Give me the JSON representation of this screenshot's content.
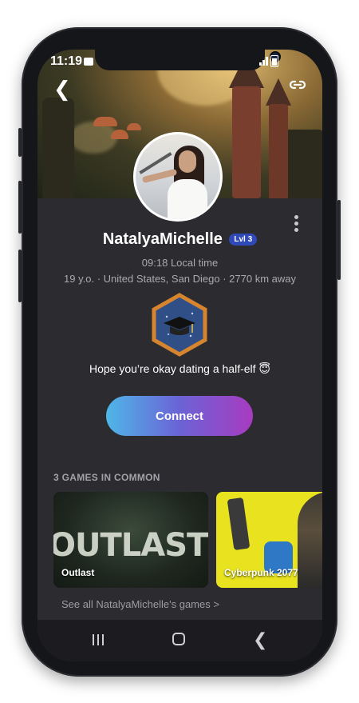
{
  "status_bar": {
    "time": "11:19"
  },
  "profile": {
    "username": "NatalyaMichelle",
    "level_badge": "Lvl 3",
    "local_time": "09:18 Local time",
    "info_line": "19 y.o. · United States, San Diego ·  2770 km away",
    "bio": "Hope you’re okay dating a half-elf 😇"
  },
  "actions": {
    "connect_label": "Connect"
  },
  "games_section": {
    "title": "3 GAMES IN COMMON",
    "games": [
      {
        "title": "Outlast",
        "art_text": "OUTLAST"
      },
      {
        "title": "Cyberpunk 2077"
      }
    ],
    "see_all": "See all NatalyaMichelle's games >"
  },
  "colors": {
    "background": "#2b2b30",
    "accent_gradient_start": "#4fb6e8",
    "accent_gradient_end": "#a83bbf",
    "level_badge": "#2f4ab8",
    "badge_hex_border": "#d6842e",
    "badge_hex_fill": "#2f4f86"
  },
  "icons": {
    "back": "back-arrow-icon",
    "share": "link-icon",
    "more": "more-vertical-icon",
    "badge": "graduation-cap-icon",
    "nav_recent": "recent-apps-icon",
    "nav_home": "home-icon",
    "nav_back": "nav-back-icon"
  }
}
